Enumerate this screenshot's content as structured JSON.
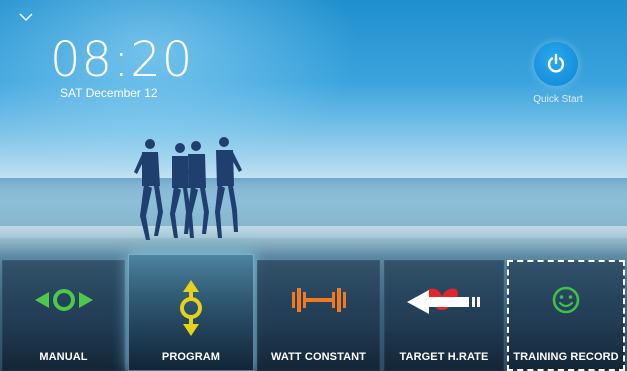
{
  "header": {
    "collapse_icon": "chevron-down-icon",
    "time": "08:20",
    "date": "SAT December 12"
  },
  "quick_start": {
    "icon": "power-icon",
    "label": "Quick Start",
    "color": "#1a9be6"
  },
  "menu": {
    "items": [
      {
        "label": "MANUAL",
        "icon": "manual-arrows-icon",
        "color": "#4cc94a"
      },
      {
        "label": "PROGRAM",
        "icon": "program-arrows-icon",
        "color": "#e6d21a"
      },
      {
        "label": "WATT CONSTANT",
        "icon": "dumbbell-icon",
        "color": "#f07a24"
      },
      {
        "label": "TARGET H.RATE",
        "icon": "heart-arrow-icon",
        "color": "#e0262b"
      },
      {
        "label": "TRAINING RECORD",
        "icon": "smiley-icon",
        "color": "#3cc24a"
      }
    ],
    "highlighted_index": 1,
    "selected_index": 4
  }
}
